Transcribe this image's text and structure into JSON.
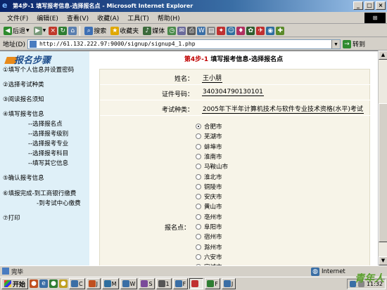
{
  "window": {
    "title": "第4步-1 填写报考信息-选择报名点 - Microsoft Internet Explorer",
    "controls": [
      "_",
      "□",
      "×"
    ]
  },
  "menu": [
    "文件(F)",
    "编辑(E)",
    "查看(V)",
    "收藏(A)",
    "工具(T)",
    "帮助(H)"
  ],
  "toolbar": {
    "back": "后退",
    "search": "搜索",
    "favorites": "收藏夹",
    "media": "媒体"
  },
  "address": {
    "label": "地址(D)",
    "url": "http://61.132.222.97:9000/signup/signup4_1.php",
    "go": "转到"
  },
  "sidebar": {
    "title": "报名步骤",
    "steps": [
      "①填写个人信息并设置密码",
      "②选择考试种类",
      "③阅读报名须知",
      "④填写报考信息"
    ],
    "substeps": [
      "--选择报名点",
      "--选择报考级别",
      "--选择报考专业",
      "--选择报考科目",
      "--填写其它信息"
    ],
    "step5": "⑤确认报考信息",
    "step6a": "⑥填报完成-到工商银行缴费",
    "step6b": "-到考试中心缴费",
    "step7": "⑦打印"
  },
  "main": {
    "step_num": "第4步-1",
    "step_title": "填写报考信息-选择报名点",
    "fields": {
      "name_label": "姓名：",
      "name_value": "王小朋",
      "id_label": "证件号码：",
      "id_value": "340304790130101",
      "exam_label": "考试种类：",
      "exam_value": "2005年下半年计算机技术与软件专业技术资格(水平)考试",
      "city_label": "报名点："
    },
    "cities": [
      "合肥市",
      "芜湖市",
      "蚌埠市",
      "淮南市",
      "马鞍山市",
      "淮北市",
      "铜陵市",
      "安庆市",
      "黄山市",
      "亳州市",
      "阜阳市",
      "宿州市",
      "滁州市",
      "六安市",
      "宣城市"
    ],
    "selected_city": "合肥市"
  },
  "status": {
    "text": "完毕",
    "zone": "Internet"
  },
  "taskbar": {
    "start": "开始",
    "buttons": [
      "C",
      "J",
      "M",
      "W",
      "S",
      "1",
      "F",
      "",
      "F",
      "J"
    ],
    "clock": "11:32"
  },
  "watermark": "青年人",
  "colors": {
    "sidebar_bg": "#dff0f8",
    "step_red": "#c00000",
    "form_bg": "#f7f4e8"
  }
}
